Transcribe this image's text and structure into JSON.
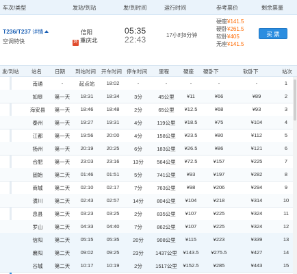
{
  "header": {
    "train_type": "车次/类型",
    "depart_arrive_station": "发站/到站",
    "depart_arrive_time": "发/到时间",
    "run_time": "运行时间",
    "ref_price": "参考票价",
    "remaining": "剩余票量"
  },
  "train": {
    "number": "T236/T237",
    "detail": "详情",
    "type": "空调特快",
    "from_station": "信阳",
    "end_badge": "终",
    "to_station": "重庆北",
    "depart_time": "05:35",
    "arrive_time": "22:43",
    "duration": "17小时8分钟",
    "prices": [
      {
        "label": "硬座",
        "value": "¥141.5"
      },
      {
        "label": "硬卧",
        "value": "¥261.5"
      },
      {
        "label": "软卧",
        "value": "¥405"
      },
      {
        "label": "无座",
        "value": "¥141.5"
      }
    ],
    "buy_label": "买 票"
  },
  "stops": {
    "side_label": "发",
    "columns": [
      "发/到站",
      "站名",
      "日期",
      "到站时间",
      "开车时间",
      "停车时间",
      "里程",
      "硬座",
      "硬卧下",
      "软卧下",
      "站次"
    ],
    "rows": [
      [
        "南通",
        "-",
        "起点站",
        "18:02",
        "-",
        "-",
        "-",
        "-",
        "-",
        "1"
      ],
      [
        "如皋",
        "第一天",
        "18:31",
        "18:34",
        "3分",
        "45公里",
        "¥11",
        "¥66",
        "¥89",
        "2"
      ],
      [
        "海安县",
        "第一天",
        "18:46",
        "18:48",
        "2分",
        "65公里",
        "¥12.5",
        "¥68",
        "¥93",
        "3"
      ],
      [
        "泰州",
        "第一天",
        "19:27",
        "19:31",
        "4分",
        "119公里",
        "¥18.5",
        "¥75",
        "¥104",
        "4"
      ],
      [
        "江都",
        "第一天",
        "19:56",
        "20:00",
        "4分",
        "158公里",
        "¥23.5",
        "¥80",
        "¥112",
        "5"
      ],
      [
        "扬州",
        "第一天",
        "20:19",
        "20:25",
        "6分",
        "183公里",
        "¥26.5",
        "¥86",
        "¥121",
        "6"
      ],
      [
        "合肥",
        "第一天",
        "23:03",
        "23:16",
        "13分",
        "564公里",
        "¥72.5",
        "¥157",
        "¥225",
        "7"
      ],
      [
        "固始",
        "第二天",
        "01:46",
        "01:51",
        "5分",
        "741公里",
        "¥93",
        "¥197",
        "¥282",
        "8"
      ],
      [
        "商城",
        "第二天",
        "02:10",
        "02:17",
        "7分",
        "763公里",
        "¥98",
        "¥206",
        "¥294",
        "9"
      ],
      [
        "潢川",
        "第二天",
        "02:43",
        "02:57",
        "14分",
        "804公里",
        "¥104",
        "¥218",
        "¥314",
        "10"
      ],
      [
        "息县",
        "第二天",
        "03:23",
        "03:25",
        "2分",
        "835公里",
        "¥107",
        "¥225",
        "¥324",
        "11"
      ],
      [
        "罗山",
        "第二天",
        "04:33",
        "04:40",
        "7分",
        "862公里",
        "¥107",
        "¥225",
        "¥324",
        "12"
      ],
      [
        "信阳",
        "第二天",
        "05:15",
        "05:35",
        "20分",
        "908公里",
        "¥115",
        "¥223",
        "¥339",
        "13"
      ],
      [
        "襄阳",
        "第二天",
        "09:02",
        "09:25",
        "23分",
        "1437公里",
        "¥143.5",
        "¥275.5",
        "¥427",
        "14"
      ],
      [
        "谷城",
        "第二天",
        "10:17",
        "10:19",
        "2分",
        "1517公里",
        "¥152.5",
        "¥285",
        "¥443",
        "15"
      ]
    ]
  }
}
